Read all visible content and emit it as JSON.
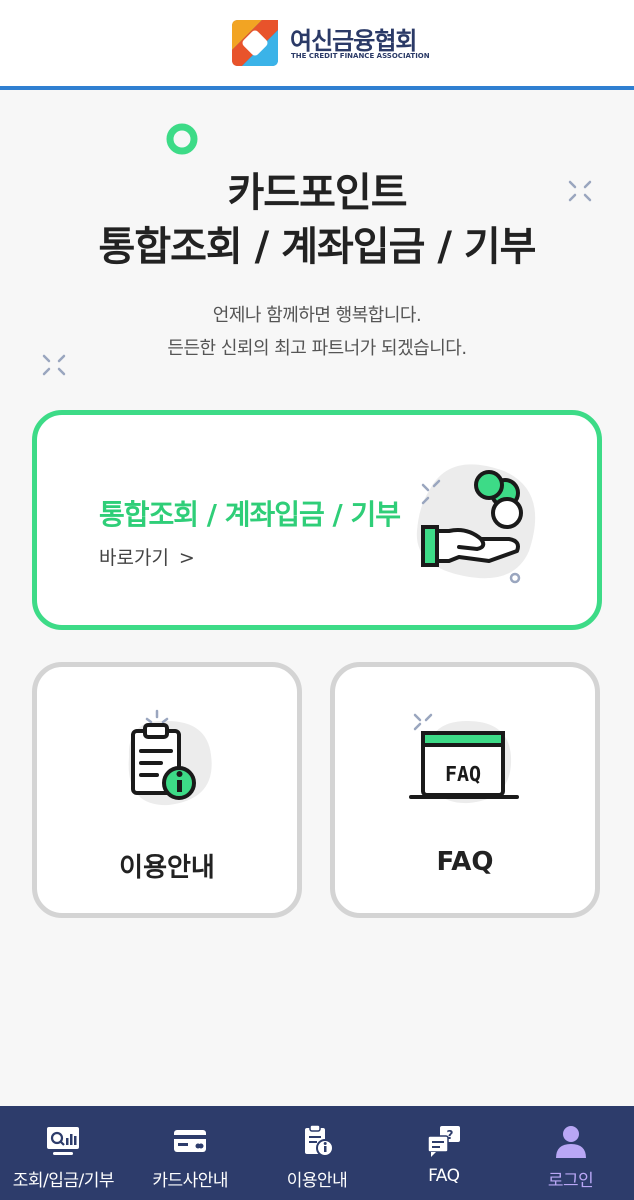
{
  "header": {
    "logo_kr": "여신금융협회",
    "logo_en": "THE CREDIT FINANCE ASSOCIATION"
  },
  "hero": {
    "title_line1": "카드포인트",
    "title_line2": "통합조회 / 계좌입금 / 기부",
    "subtitle_line1": "언제나 함께하면 행복합니다.",
    "subtitle_line2": "든든한 신뢰의 최고 파트너가 되겠습니다."
  },
  "main_card": {
    "title": "통합조회 / 계좌입금 / 기부",
    "link_label": "바로가기",
    "chevron": ">"
  },
  "cards": {
    "guide_label": "이용안내",
    "faq_label": "FAQ",
    "faq_icon_text": "FAQ"
  },
  "bottom_nav": {
    "items": [
      {
        "label": "조회/입금/기부",
        "icon": "chart-monitor-icon"
      },
      {
        "label": "카드사안내",
        "icon": "card-icon"
      },
      {
        "label": "이용안내",
        "icon": "clipboard-info-icon"
      },
      {
        "label": "FAQ",
        "icon": "faq-chat-icon"
      },
      {
        "label": "로그인",
        "icon": "user-icon",
        "active": true
      }
    ]
  },
  "colors": {
    "accent_green": "#3ddb87",
    "nav_bg": "#2d3c6b",
    "header_line": "#2f7fd1",
    "active_nav": "#b9a7f5"
  }
}
